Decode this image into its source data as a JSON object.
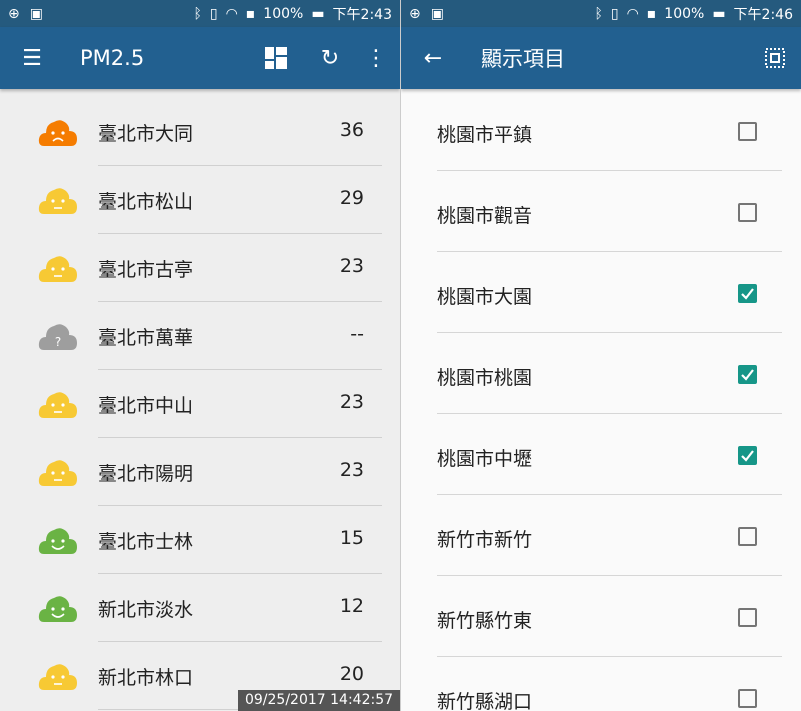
{
  "left": {
    "status": {
      "battery": "100%",
      "time": "下午2:43"
    },
    "toolbar": {
      "title": "PM2.5"
    },
    "stations": [
      {
        "name": "臺北市大同",
        "value": "36",
        "mood": "sad",
        "color": "#f57c00"
      },
      {
        "name": "臺北市松山",
        "value": "29",
        "mood": "neutral",
        "color": "#f7c934"
      },
      {
        "name": "臺北市古亭",
        "value": "23",
        "mood": "neutral",
        "color": "#f7c934"
      },
      {
        "name": "臺北市萬華",
        "value": "--",
        "mood": "unknown",
        "color": "#9e9e9e"
      },
      {
        "name": "臺北市中山",
        "value": "23",
        "mood": "neutral",
        "color": "#f7c934"
      },
      {
        "name": "臺北市陽明",
        "value": "23",
        "mood": "neutral",
        "color": "#f7c934"
      },
      {
        "name": "臺北市士林",
        "value": "15",
        "mood": "happy",
        "color": "#6ab344"
      },
      {
        "name": "新北市淡水",
        "value": "12",
        "mood": "happy",
        "color": "#6ab344"
      },
      {
        "name": "新北市林口",
        "value": "20",
        "mood": "neutral",
        "color": "#f7c934"
      }
    ],
    "timestamp": "09/25/2017 14:42:57"
  },
  "right": {
    "status": {
      "battery": "100%",
      "time": "下午2:46"
    },
    "toolbar": {
      "title": "顯示項目"
    },
    "items": [
      {
        "name": "桃園市平鎮",
        "checked": false
      },
      {
        "name": "桃園市觀音",
        "checked": false
      },
      {
        "name": "桃園市大園",
        "checked": true
      },
      {
        "name": "桃園市桃園",
        "checked": true
      },
      {
        "name": "桃園市中壢",
        "checked": true
      },
      {
        "name": "新竹市新竹",
        "checked": false
      },
      {
        "name": "新竹縣竹東",
        "checked": false
      },
      {
        "name": "新竹縣湖口",
        "checked": false
      }
    ]
  }
}
